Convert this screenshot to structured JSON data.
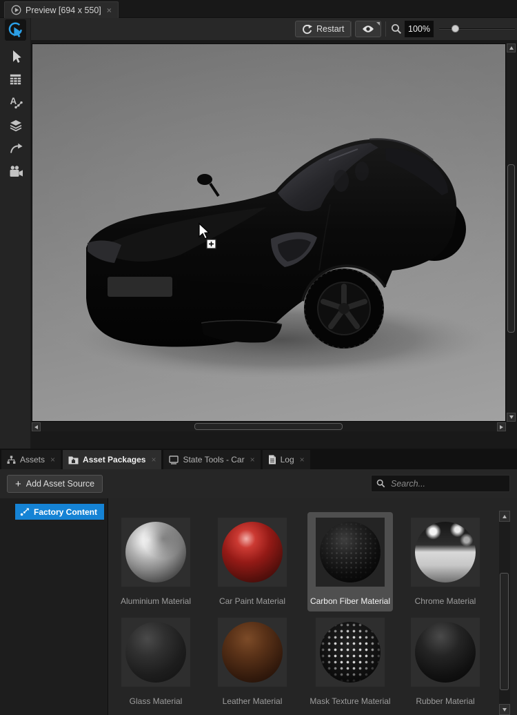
{
  "preview": {
    "tab_title": "Preview [694 x 550]",
    "restart_label": "Restart",
    "zoom_level": "100%"
  },
  "icons": {
    "close": "×",
    "plus": "+"
  },
  "tool_strip": {
    "icon_names": [
      "interact-pointer",
      "select-cursor",
      "data-table",
      "font-animation",
      "layers",
      "transition-arrow",
      "camera"
    ],
    "active_tool": "interact-pointer"
  },
  "bottom_tabs": [
    {
      "label": "Assets"
    },
    {
      "label": "Asset Packages"
    },
    {
      "label": "State Tools - Car"
    },
    {
      "label": "Log"
    }
  ],
  "asset_toolbar": {
    "add_source_label": "Add Asset Source",
    "search_placeholder": "Search..."
  },
  "sources": {
    "factory_content_label": "Factory Content"
  },
  "materials": [
    {
      "name": "Aluminium Material"
    },
    {
      "name": "Car Paint Material"
    },
    {
      "name": "Carbon Fiber Material"
    },
    {
      "name": "Chrome Material"
    },
    {
      "name": "Glass Material"
    },
    {
      "name": "Leather Material"
    },
    {
      "name": "Mask Texture Material"
    },
    {
      "name": "Rubber Material"
    }
  ],
  "selection": {
    "active_bottom_tab": "Asset Packages",
    "selected_material": "Carbon Fiber Material"
  },
  "colors": {
    "accent_blue": "#1583d5",
    "active_tool_blue": "#2b9fe6",
    "selection_gray": "#4f4f4f"
  }
}
